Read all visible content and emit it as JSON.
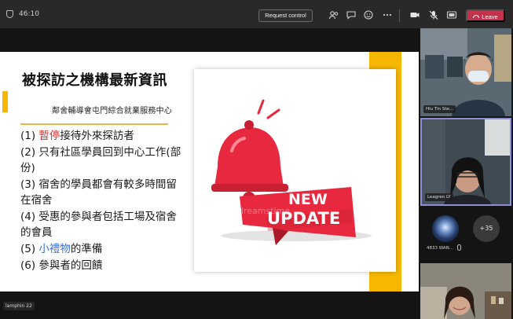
{
  "topbar": {
    "timer": "46:10",
    "request_control": "Request control",
    "leave": "Leave"
  },
  "slide": {
    "title": "被探訪之機構最新資訊",
    "org": "鄰舍輔導會屯門綜合就業服務中心",
    "items": [
      {
        "num": "(1) ",
        "highlight": "暫停",
        "rest": "接待外來探訪者",
        "color": "#e0302e"
      },
      {
        "num": "(2) ",
        "highlight": "",
        "rest": "只有社區學員回到中心工作(部份)",
        "color": ""
      },
      {
        "num": "(3) ",
        "highlight": "",
        "rest": "宿舍的學員都會有較多時間留在宿舍",
        "color": ""
      },
      {
        "num": "(4) ",
        "highlight": "",
        "rest": "受惠的參與者包括工場及宿舍的會員",
        "color": ""
      },
      {
        "num": "(5) ",
        "highlight": "小禮物",
        "rest": "的準備",
        "color": "#3a6fd8"
      },
      {
        "num": "(6) ",
        "highlight": "",
        "rest": "參與者的回饋",
        "color": ""
      }
    ],
    "badge": {
      "line1": "NEW",
      "line2": "UPDATE",
      "watermark": "dreamstime"
    },
    "presenter": "lamphin 22"
  },
  "participants": {
    "tile1_name": "Hiu Tin Ste...",
    "tile2_name": "Leagren LY",
    "avatar_name": "4833 WAN...",
    "more_count": "+35"
  },
  "colors": {
    "accent": "#f6b700",
    "badge_red": "#e8283e",
    "leave": "#c4314b",
    "active_border": "#8a8fd8"
  }
}
